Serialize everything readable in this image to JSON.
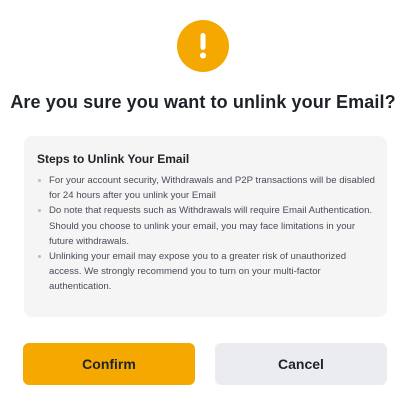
{
  "dialog": {
    "icon": "exclamation-icon",
    "accent_color": "#F5A800",
    "title": "Are you sure you want to unlink your Email?",
    "steps": {
      "heading": "Steps to Unlink Your Email",
      "items": [
        "For your account security, Withdrawals and P2P transactions will be disabled for 24 hours after you unlink your Email",
        "Do note that requests such as Withdrawals will require Email Authentication. Should you choose to unlink your email, you may face limitations in your future withdrawals.",
        "Unlinking your email may expose you to a greater risk of unauthorized access. We strongly recommend you to turn on your multi-factor authentication."
      ]
    },
    "buttons": {
      "confirm_label": "Confirm",
      "cancel_label": "Cancel"
    }
  }
}
